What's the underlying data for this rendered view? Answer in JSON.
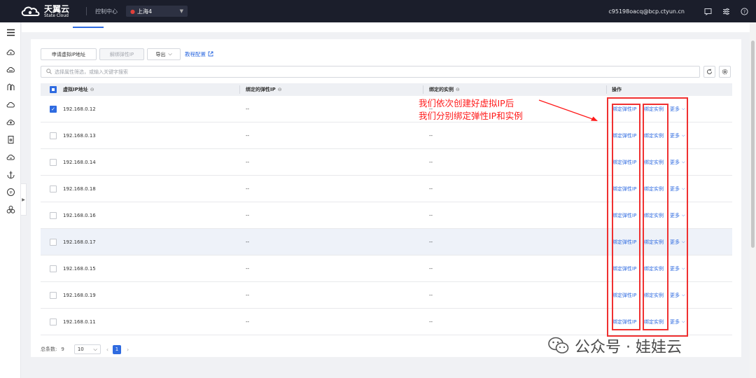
{
  "topbar": {
    "brand_cn": "天翼云",
    "brand_en": "State Cloud",
    "console_label": "控制中心",
    "region": "上海4",
    "account": "c95198oacq@bcp.ctyun.cn"
  },
  "toolbar": {
    "apply_label": "申请虚拟IP地址",
    "unbind_label": "解绑弹性IP",
    "export_label": "导出",
    "doc_link_label": "教程配置"
  },
  "search": {
    "placeholder": "选择属性筛选，或输入关键字搜索"
  },
  "table": {
    "headers": {
      "vip": "虚拟IP地址",
      "eip": "绑定的弹性IP",
      "instance": "绑定的实例",
      "ops": "操作"
    },
    "rows": [
      {
        "ip": "192.168.0.12",
        "eip": "--",
        "instance": "--",
        "checked": true
      },
      {
        "ip": "192.168.0.13",
        "eip": "--",
        "instance": "--",
        "checked": false
      },
      {
        "ip": "192.168.0.14",
        "eip": "--",
        "instance": "--",
        "checked": false
      },
      {
        "ip": "192.168.0.18",
        "eip": "--",
        "instance": "--",
        "checked": false
      },
      {
        "ip": "192.168.0.16",
        "eip": "--",
        "instance": "--",
        "checked": false
      },
      {
        "ip": "192.168.0.17",
        "eip": "--",
        "instance": "--",
        "checked": false
      },
      {
        "ip": "192.168.0.15",
        "eip": "--",
        "instance": "--",
        "checked": false
      },
      {
        "ip": "192.168.0.19",
        "eip": "--",
        "instance": "--",
        "checked": false
      },
      {
        "ip": "192.168.0.11",
        "eip": "--",
        "instance": "--",
        "checked": false
      }
    ],
    "row_actions": {
      "bind_eip": "绑定弹性IP",
      "bind_instance": "绑定实例",
      "more": "更多"
    }
  },
  "pagination": {
    "total_label": "总条数:",
    "total": "9",
    "page_size": "10",
    "current_page": "1"
  },
  "annotation": {
    "line1": "我们依次创建好虚拟IP后",
    "line2": "我们分别绑定弹性IP和实例",
    "color": "#ff1a1a"
  },
  "watermark": {
    "text": "公众号 · 娃娃云"
  },
  "colors": {
    "accent": "#2f6be0",
    "topbar": "#1b1e2b"
  }
}
